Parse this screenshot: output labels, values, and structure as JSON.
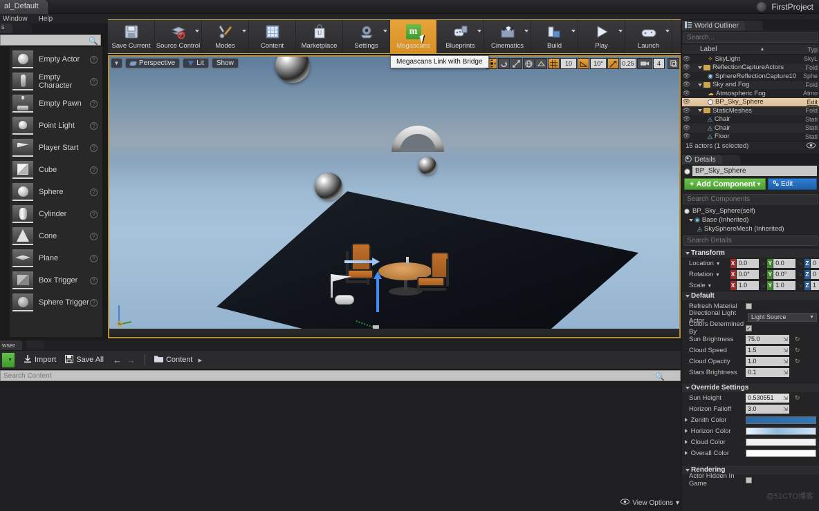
{
  "titlebar": {
    "level_tab": "al_Default",
    "project": "FirstProject",
    "logo_icon": "ue-logo-icon"
  },
  "menubar": {
    "items": [
      {
        "label": "Window"
      },
      {
        "label": "Help"
      }
    ]
  },
  "modes": {
    "tab_label": "s",
    "search_placeholder": "",
    "search_icon": "search-icon"
  },
  "place_actors": {
    "items": [
      {
        "label": "Empty Actor",
        "icon": "sphere-thumb-icon",
        "help": "?"
      },
      {
        "label": "Empty Character",
        "icon": "character-thumb-icon",
        "help": "?"
      },
      {
        "label": "Empty Pawn",
        "icon": "pawn-thumb-icon",
        "help": "?"
      },
      {
        "label": "Point Light",
        "icon": "bulb-thumb-icon",
        "help": "?"
      },
      {
        "label": "Player Start",
        "icon": "flag-thumb-icon",
        "help": "?"
      },
      {
        "label": "Cube",
        "icon": "cube-thumb-icon",
        "help": "?"
      },
      {
        "label": "Sphere",
        "icon": "sphere-thumb-icon",
        "help": "?"
      },
      {
        "label": "Cylinder",
        "icon": "cylinder-thumb-icon",
        "help": "?"
      },
      {
        "label": "Cone",
        "icon": "cone-thumb-icon",
        "help": "?"
      },
      {
        "label": "Plane",
        "icon": "plane-thumb-icon",
        "help": "?"
      },
      {
        "label": "Box Trigger",
        "icon": "box-trigger-thumb-icon",
        "help": "?"
      },
      {
        "label": "Sphere Trigger",
        "icon": "sphere-trigger-thumb-icon",
        "help": "?"
      }
    ]
  },
  "toolbar": {
    "buttons": [
      {
        "label": "Save Current",
        "icon": "floppy-disk-icon",
        "dropdown": false
      },
      {
        "label": "Source Control",
        "icon": "source-control-icon",
        "dropdown": true
      },
      {
        "label": "Modes",
        "icon": "wrench-screwdriver-icon",
        "dropdown": true
      },
      {
        "label": "Content",
        "icon": "content-grid-icon",
        "dropdown": false
      },
      {
        "label": "Marketplace",
        "icon": "shopping-bag-icon",
        "dropdown": false
      },
      {
        "label": "Settings",
        "icon": "gear-stack-icon",
        "dropdown": true
      },
      {
        "label": "Megascans",
        "icon": "megascans-m-icon",
        "dropdown": false,
        "active": true
      },
      {
        "label": "Blueprints",
        "icon": "blueprint-icon",
        "dropdown": true
      },
      {
        "label": "Cinematics",
        "icon": "clapperboard-icon",
        "dropdown": true
      },
      {
        "label": "Build",
        "icon": "build-blocks-icon",
        "dropdown": true
      },
      {
        "label": "Play",
        "icon": "play-triangle-icon",
        "dropdown": true
      },
      {
        "label": "Launch",
        "icon": "launch-gamepad-icon",
        "dropdown": true
      }
    ],
    "tooltip": "Megascans Link with Bridge",
    "megascans_glyph": "m",
    "accent_color": "#d98f22"
  },
  "viewport": {
    "left_controls": [
      {
        "label": "",
        "icon": "viewport-options-chevron-icon"
      },
      {
        "label": "Perspective",
        "icon": "camera-icon"
      },
      {
        "label": "Lit",
        "icon": "lit-icon"
      },
      {
        "label": "Show",
        "icon": ""
      }
    ],
    "right_controls": [
      {
        "name": "translate-mode",
        "icon": "move-gizmo-icon",
        "active": true
      },
      {
        "name": "rotate-mode",
        "icon": "rotate-icon",
        "active": false
      },
      {
        "name": "scale-mode",
        "icon": "scale-icon",
        "active": false
      },
      {
        "name": "coordinate-system",
        "icon": "globe-icon",
        "active": false
      },
      {
        "name": "surface-snap",
        "icon": "surface-snap-icon",
        "active": false
      },
      {
        "name": "grid-snap-toggle",
        "icon": "grid-icon",
        "active": true
      },
      {
        "name": "grid-snap-value",
        "value": "10"
      },
      {
        "name": "rotation-snap-toggle",
        "icon": "angle-icon",
        "active": true
      },
      {
        "name": "rotation-snap-value",
        "value": "10°"
      },
      {
        "name": "scale-snap-toggle",
        "icon": "scale-snap-icon",
        "active": true
      },
      {
        "name": "scale-snap-value",
        "value": "0.25"
      },
      {
        "name": "camera-speed",
        "icon": "camera-speed-icon",
        "value": "4"
      },
      {
        "name": "maximize-viewport",
        "icon": "maximize-icon"
      }
    ]
  },
  "content_browser": {
    "tab_label": "wser",
    "add_new_icon": "add-new-icon",
    "buttons": [
      {
        "label": "Import",
        "icon": "import-icon"
      },
      {
        "label": "Save All",
        "icon": "save-all-icon"
      }
    ],
    "nav": {
      "back_icon": "arrow-left-icon",
      "forward_icon": "arrow-right-icon"
    },
    "breadcrumb": {
      "folder_icon": "folder-icon",
      "label": "Content",
      "chevron": "▸"
    },
    "search_placeholder": "Search Content",
    "search_icon": "search-icon",
    "view_options": {
      "label": "View Options",
      "icon": "eye-icon",
      "chevron": "▾"
    }
  },
  "world_outliner": {
    "tab_label": "World Outliner",
    "tab_icon": "outliner-icon",
    "search_placeholder": "Search...",
    "columns": {
      "label": "Label",
      "type": "Typ"
    },
    "sort_icon": "sort-asc-icon",
    "rows": [
      {
        "label": "SkyLight",
        "type": "SkyL",
        "indent": 2,
        "icon": "skylight-icon",
        "selected": false
      },
      {
        "label": "ReflectionCaptureActors",
        "type": "Fold",
        "indent": 1,
        "icon": "folder-icon",
        "expander": "▴",
        "selected": false
      },
      {
        "label": "SphereReflectionCapture10",
        "type": "Sphe",
        "indent": 2,
        "icon": "reflection-capture-icon",
        "selected": false
      },
      {
        "label": "Sky and Fog",
        "type": "Fold",
        "indent": 1,
        "icon": "folder-icon",
        "expander": "▴",
        "selected": false
      },
      {
        "label": "Atmospheric Fog",
        "type": "Atmo",
        "indent": 2,
        "icon": "fog-icon",
        "selected": false
      },
      {
        "label": "BP_Sky_Sphere",
        "type": "Edit",
        "indent": 2,
        "icon": "sphere-icon",
        "selected": true
      },
      {
        "label": "StaticMeshes",
        "type": "Fold",
        "indent": 1,
        "icon": "folder-icon",
        "expander": "▴",
        "selected": false
      },
      {
        "label": "Chair",
        "type": "Stati",
        "indent": 2,
        "icon": "static-mesh-icon",
        "selected": false
      },
      {
        "label": "Chair",
        "type": "Stati",
        "indent": 2,
        "icon": "static-mesh-icon",
        "selected": false
      },
      {
        "label": "Floor",
        "type": "Stati",
        "indent": 2,
        "icon": "static-mesh-icon",
        "selected": false
      }
    ],
    "footer": {
      "count": "15 actors (1 selected)",
      "eye_icon": "eye-icon"
    }
  },
  "details": {
    "tab_label": "Details",
    "tab_icon": "details-icon",
    "actor_name": "BP_Sky_Sphere",
    "add_component": {
      "label": "Add Component",
      "plus": "+",
      "chevron": "▾"
    },
    "edit_blueprint": {
      "label": "Edit",
      "icon": "blueprint-edit-icon"
    },
    "component_search_placeholder": "Search Components",
    "components": [
      {
        "label": "BP_Sky_Sphere(self)",
        "icon": "sphere-icon",
        "indent": 0
      },
      {
        "label": "Base (Inherited)",
        "icon": "base-component-icon",
        "indent": 1,
        "expander": "▴"
      },
      {
        "label": "SkySphereMesh (Inherited)",
        "icon": "static-mesh-icon",
        "indent": 2
      }
    ],
    "details_search_placeholder": "Search Details",
    "transform": {
      "section": "Transform",
      "rows": [
        {
          "label": "Location",
          "dropdown": true,
          "x": "0.0",
          "y": "0.0",
          "z": "0"
        },
        {
          "label": "Rotation",
          "dropdown": true,
          "x": "0.0°",
          "y": "0.0°",
          "z": "0"
        },
        {
          "label": "Scale",
          "dropdown": true,
          "x": "1.0",
          "y": "1.0",
          "z": "1"
        }
      ]
    },
    "default_section": {
      "section": "Default",
      "refresh_material": {
        "label": "Refresh Material",
        "checked": false
      },
      "directional_light_actor": {
        "label": "Directional Light Actor",
        "value": "Light Source"
      },
      "colors_determined_by": {
        "label": "Colors Determined By",
        "checked": true
      },
      "fields": [
        {
          "label": "Sun Brightness",
          "value": "75.0",
          "reset": true
        },
        {
          "label": "Cloud Speed",
          "value": "1.5",
          "reset": true
        },
        {
          "label": "Cloud Opacity",
          "value": "1.0",
          "reset": true
        },
        {
          "label": "Stars Brightness",
          "value": "0.1",
          "reset": false
        }
      ]
    },
    "override_settings": {
      "section": "Override Settings",
      "fields": [
        {
          "label": "Sun Height",
          "value": "0.530551",
          "reset": true
        },
        {
          "label": "Horizon Falloff",
          "value": "3.0",
          "reset": false
        }
      ],
      "colors": [
        {
          "label": "Zenith Color",
          "color": "#2f6ba5"
        },
        {
          "label": "Horizon Color",
          "color": "#cfe2f5"
        },
        {
          "label": "Cloud Color",
          "color": "#f2f2f2"
        },
        {
          "label": "Overall Color",
          "color": "#ffffff"
        }
      ]
    },
    "rendering": {
      "section": "Rendering",
      "actor_hidden_in_game": {
        "label": "Actor Hidden In Game",
        "checked": false
      }
    }
  },
  "watermark": "@51CTO博客"
}
